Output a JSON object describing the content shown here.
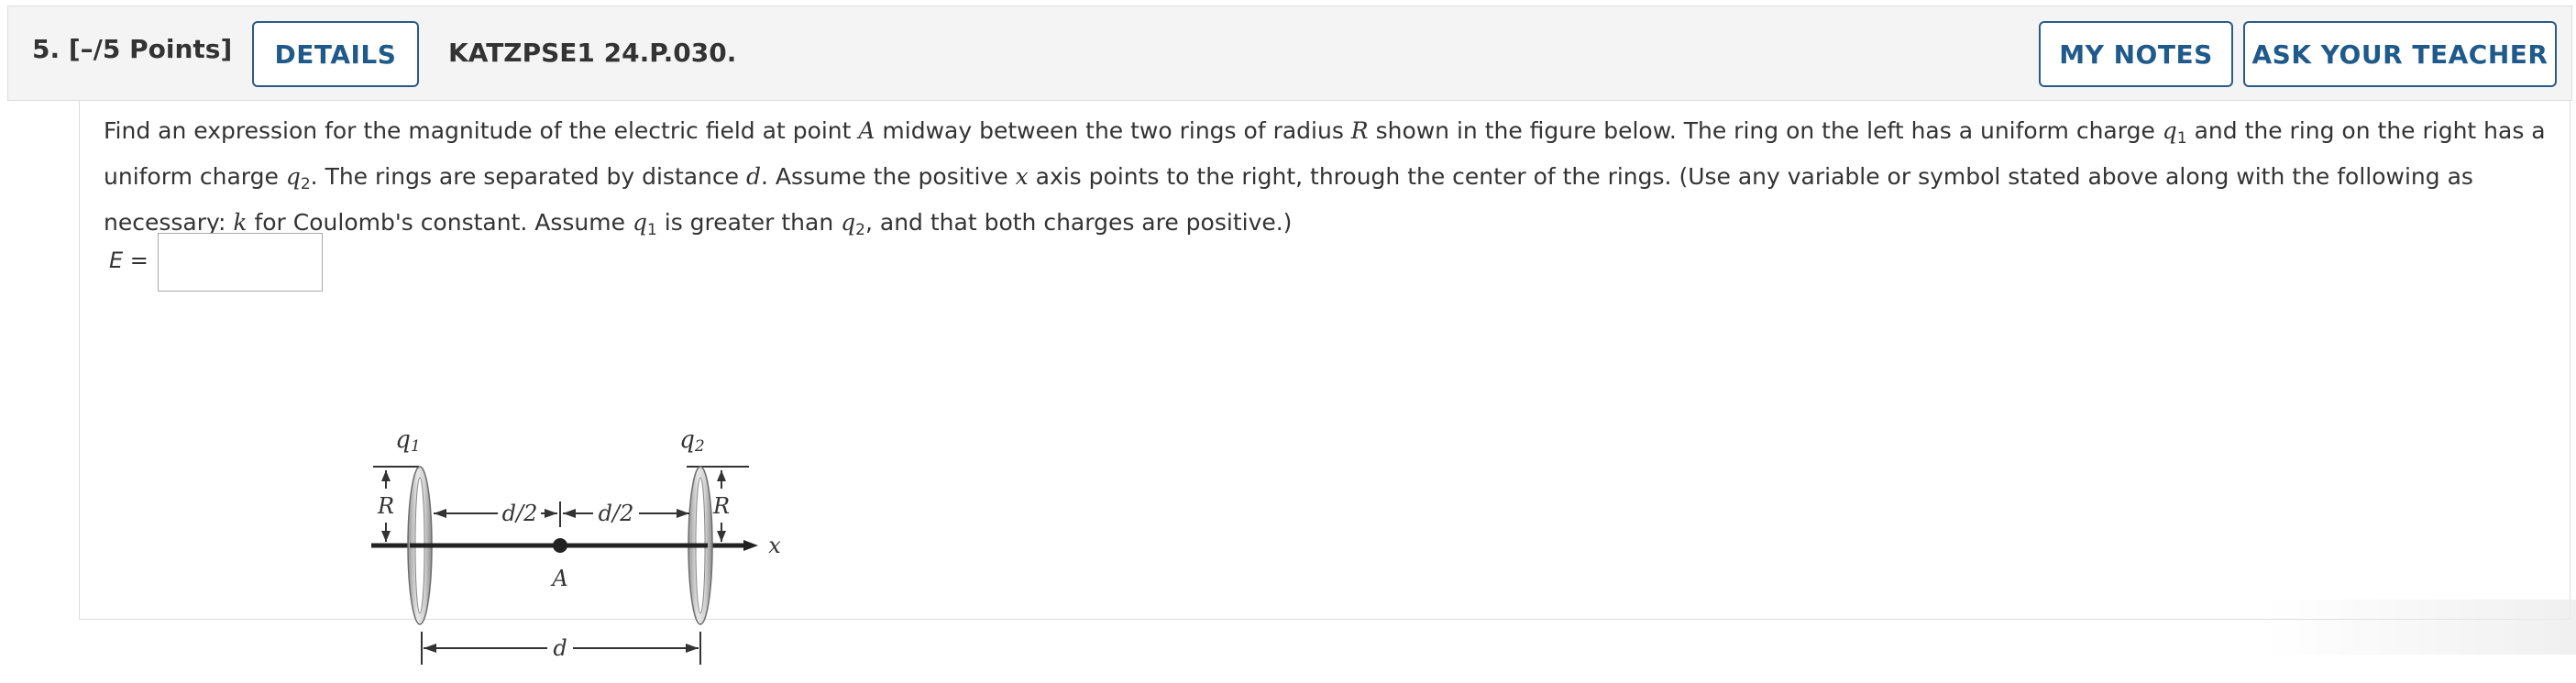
{
  "header": {
    "question_label": "5.  [–/5 Points]",
    "details_label": "DETAILS",
    "problem_code": "KATZPSE1 24.P.030.",
    "my_notes_label": "MY NOTES",
    "ask_teacher_label": "ASK YOUR TEACHER"
  },
  "question": {
    "segments": [
      "Find an expression for the magnitude of the electric field at point ",
      "A",
      " midway between the two rings of radius ",
      "R",
      " shown in the figure below. The ring on the left has a uniform charge ",
      "q",
      "1",
      " and the ring on the right has a uniform charge ",
      "q",
      "2",
      ". The rings are separated by distance ",
      "d",
      ". Assume the positive ",
      "x",
      " axis points to the right, through the center of the rings. (Use any variable or symbol stated above along with the following as necessary: ",
      "k",
      " for Coulomb's constant. Assume ",
      "q",
      "1",
      " is greater than ",
      "q",
      "2",
      ", and that both charges are positive.)"
    ]
  },
  "answer": {
    "label": "E =",
    "value": ""
  },
  "figure": {
    "q1_label": "q",
    "q1_sub": "1",
    "q2_label": "q",
    "q2_sub": "2",
    "r_label_left": "R",
    "r_label_right": "R",
    "half_d_left": "d/2",
    "half_d_right": "d/2",
    "point_label": "A",
    "axis_label": "x",
    "d_label": "d"
  }
}
